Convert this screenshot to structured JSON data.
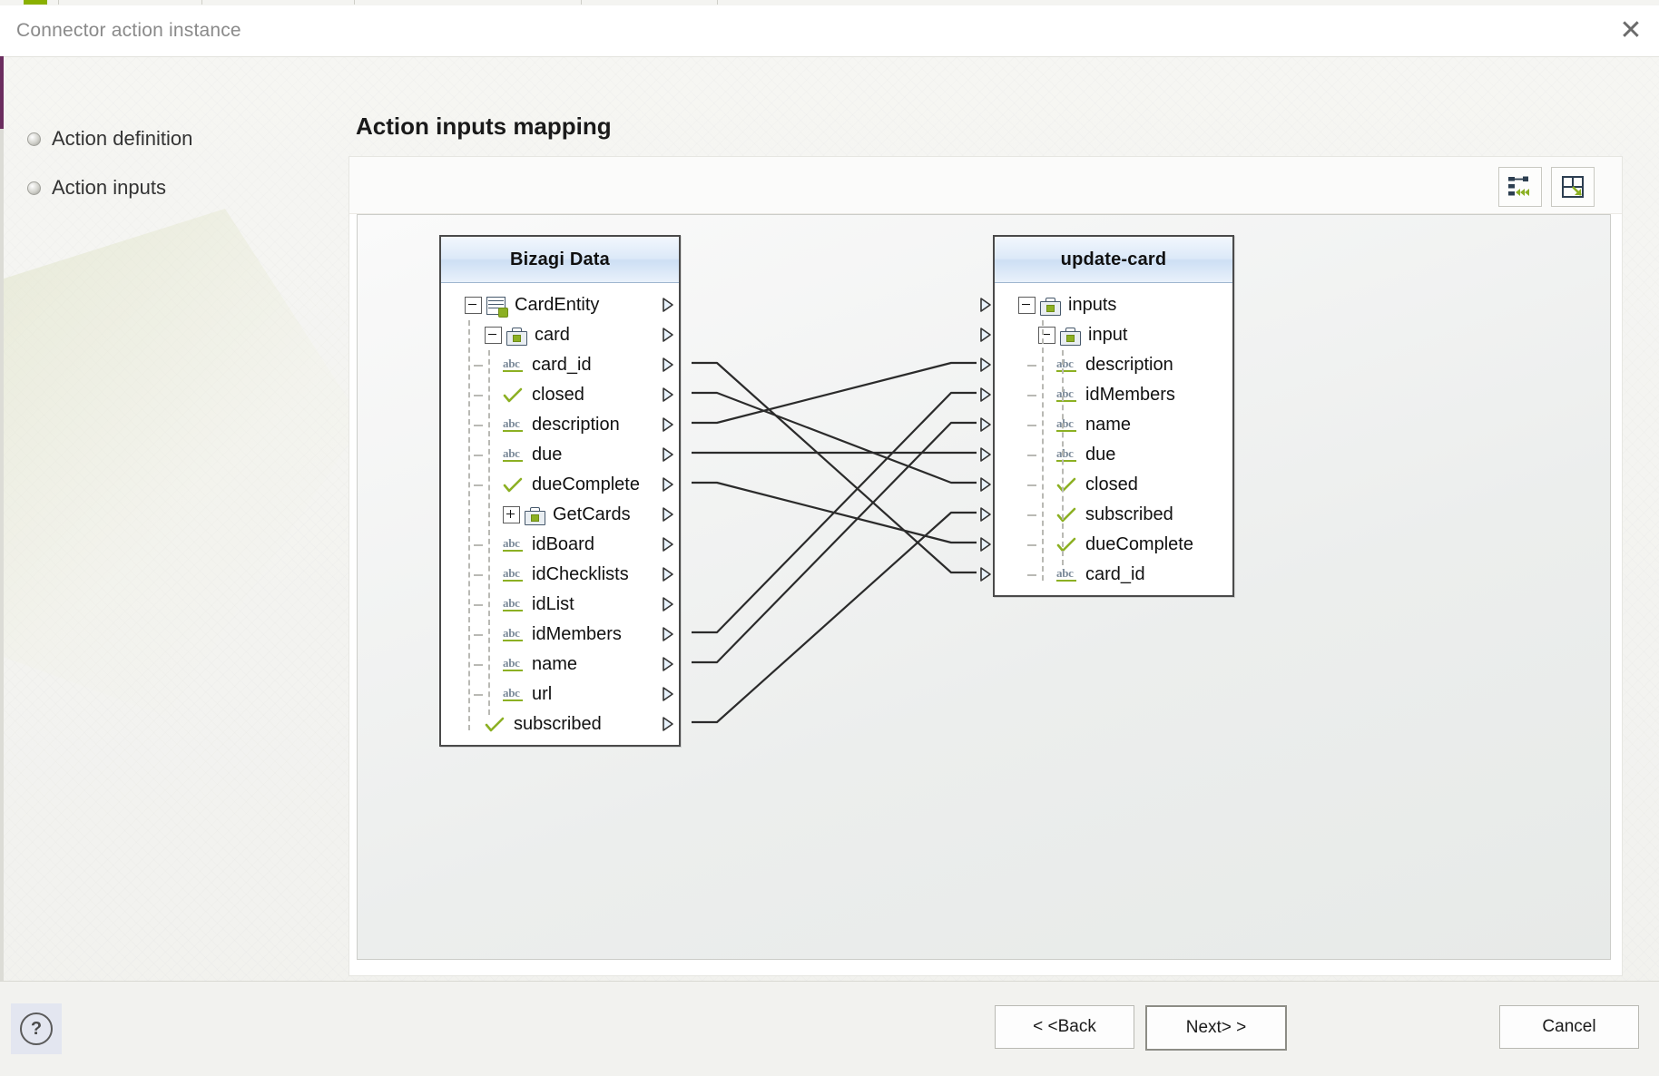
{
  "window": {
    "title": "Connector action instance",
    "close_label": "✕"
  },
  "sidebar": {
    "items": [
      {
        "label": "Action definition"
      },
      {
        "label": "Action inputs"
      }
    ]
  },
  "main": {
    "page_title": "Action inputs mapping",
    "toolbar": {
      "autolink_tooltip": "auto-map-icon",
      "fit_tooltip": "fit-to-view-icon"
    }
  },
  "mapping": {
    "source": {
      "title": "Bizagi Data",
      "nodes": [
        {
          "label": "CardEntity",
          "icon": "entity",
          "indent": 0,
          "expander": "minus",
          "connected": false
        },
        {
          "label": "card",
          "icon": "case",
          "indent": 1,
          "expander": "minus",
          "connected": false
        },
        {
          "label": "card_id",
          "icon": "abc",
          "indent": 2,
          "expander": "none",
          "connected": true
        },
        {
          "label": "closed",
          "icon": "check",
          "indent": 2,
          "expander": "none",
          "connected": true
        },
        {
          "label": "description",
          "icon": "abc",
          "indent": 2,
          "expander": "none",
          "connected": true
        },
        {
          "label": "due",
          "icon": "abc",
          "indent": 2,
          "expander": "none",
          "connected": true
        },
        {
          "label": "dueComplete",
          "icon": "check",
          "indent": 2,
          "expander": "none",
          "connected": true
        },
        {
          "label": "GetCards",
          "icon": "case",
          "indent": 2,
          "expander": "plus",
          "connected": false
        },
        {
          "label": "idBoard",
          "icon": "abc",
          "indent": 2,
          "expander": "none",
          "connected": false
        },
        {
          "label": "idChecklists",
          "icon": "abc",
          "indent": 2,
          "expander": "none",
          "connected": false
        },
        {
          "label": "idList",
          "icon": "abc",
          "indent": 2,
          "expander": "none",
          "connected": false
        },
        {
          "label": "idMembers",
          "icon": "abc",
          "indent": 2,
          "expander": "none",
          "connected": true
        },
        {
          "label": "name",
          "icon": "abc",
          "indent": 2,
          "expander": "none",
          "connected": true
        },
        {
          "label": "url",
          "icon": "abc",
          "indent": 2,
          "expander": "none",
          "connected": false
        },
        {
          "label": "subscribed",
          "icon": "check",
          "indent": 1,
          "expander": "none",
          "connected": true
        }
      ]
    },
    "target": {
      "title": "update-card",
      "nodes": [
        {
          "label": "inputs",
          "icon": "case",
          "indent": 0,
          "expander": "minus",
          "connected": false
        },
        {
          "label": "input",
          "icon": "case",
          "indent": 1,
          "expander": "minus",
          "connected": false
        },
        {
          "label": "description",
          "icon": "abc",
          "indent": 2,
          "expander": "none",
          "connected": true
        },
        {
          "label": "idMembers",
          "icon": "abc",
          "indent": 2,
          "expander": "none",
          "connected": true
        },
        {
          "label": "name",
          "icon": "abc",
          "indent": 2,
          "expander": "none",
          "connected": true
        },
        {
          "label": "due",
          "icon": "abc",
          "indent": 2,
          "expander": "none",
          "connected": true
        },
        {
          "label": "closed",
          "icon": "check",
          "indent": 2,
          "expander": "none",
          "connected": true
        },
        {
          "label": "subscribed",
          "icon": "check",
          "indent": 2,
          "expander": "none",
          "connected": true
        },
        {
          "label": "dueComplete",
          "icon": "check",
          "indent": 2,
          "expander": "none",
          "connected": true
        },
        {
          "label": "card_id",
          "icon": "abc",
          "indent": 2,
          "expander": "none",
          "connected": true
        }
      ]
    },
    "links": [
      {
        "from": "card_id",
        "to": "card_id"
      },
      {
        "from": "closed",
        "to": "closed"
      },
      {
        "from": "description",
        "to": "description"
      },
      {
        "from": "due",
        "to": "due"
      },
      {
        "from": "dueComplete",
        "to": "dueComplete"
      },
      {
        "from": "idMembers",
        "to": "idMembers"
      },
      {
        "from": "name",
        "to": "name"
      },
      {
        "from": "subscribed",
        "to": "subscribed"
      }
    ]
  },
  "footer": {
    "help_label": "?",
    "back_label": "< <Back",
    "next_label": "Next> >",
    "cancel_label": "Cancel"
  },
  "colors": {
    "accent_green": "#8cb023",
    "icon_navy": "#46586b",
    "header_blue": "#cddff4",
    "link_line": "#2b2b2b"
  }
}
